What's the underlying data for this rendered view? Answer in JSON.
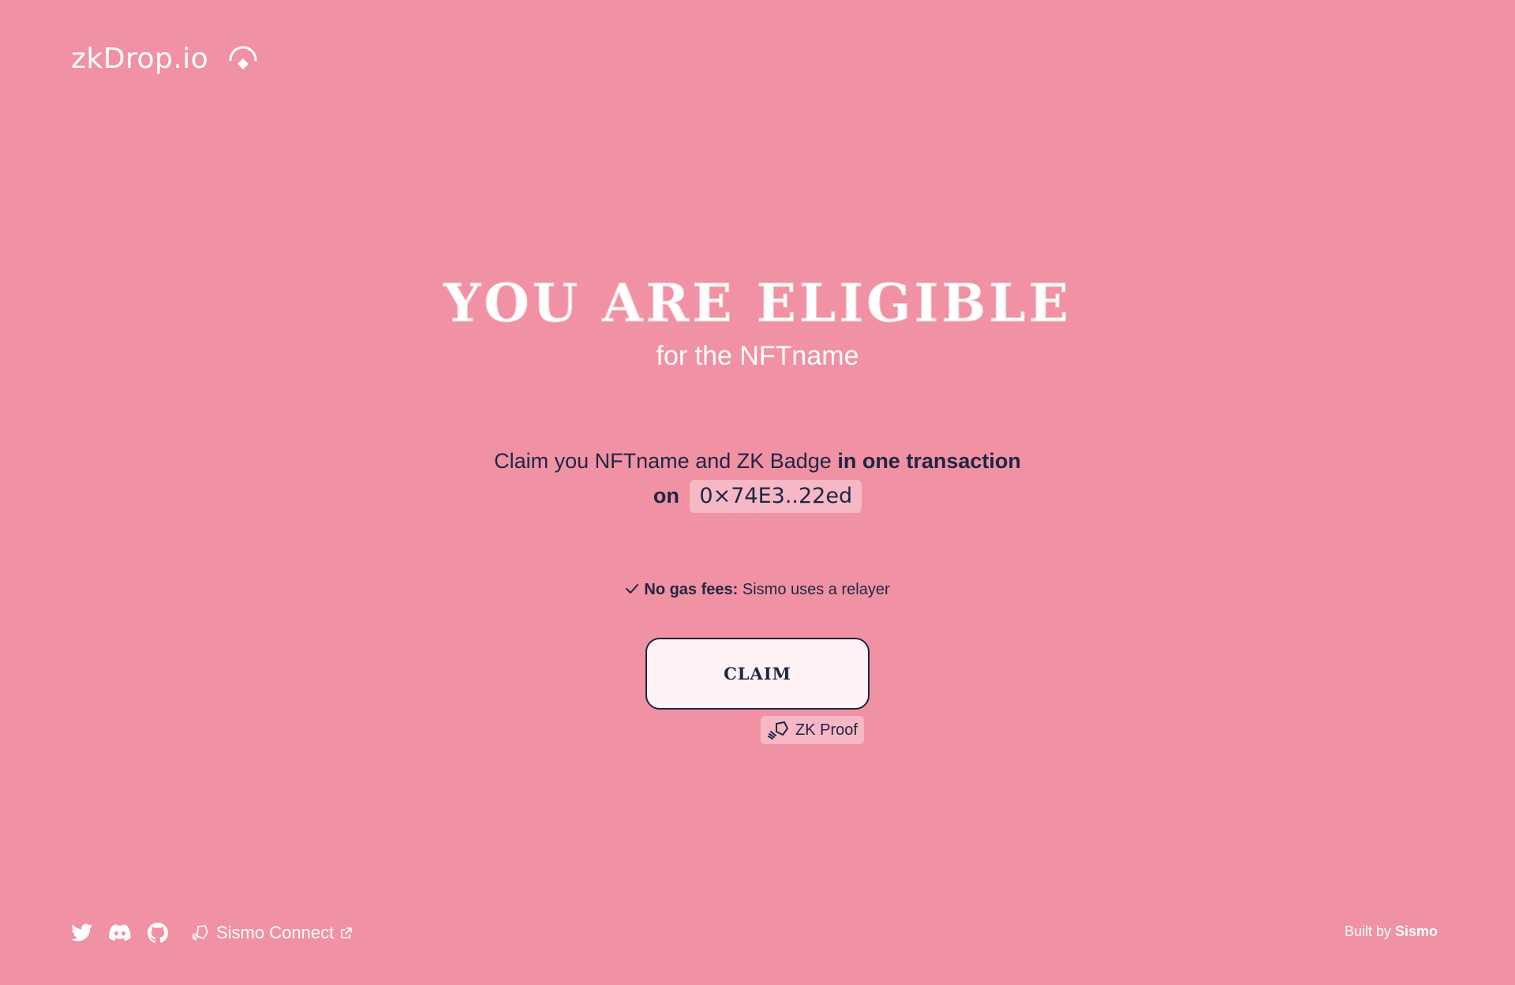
{
  "header": {
    "logo_text": "zkDrop.io",
    "logo_icon": "zkdrop-drop-icon"
  },
  "hero": {
    "title": "YOU ARE ELIGIBLE",
    "subtitle": "for the NFTname"
  },
  "claim": {
    "text_prefix": "Claim you NFTname and ZK Badge ",
    "text_bold": "in one transaction",
    "on_label": "on",
    "address": "0×74E3..22ed"
  },
  "gas": {
    "icon": "check-icon",
    "label_bold": "No gas fees:",
    "label_rest": " Sismo uses a relayer"
  },
  "claim_button": {
    "label": "CLAIM"
  },
  "zk_badge": {
    "icon": "zk-proof-icon",
    "label": "ZK Proof"
  },
  "footer": {
    "social": [
      {
        "name": "twitter-icon"
      },
      {
        "name": "discord-icon"
      },
      {
        "name": "github-icon"
      }
    ],
    "connect_label": "Sismo Connect",
    "built_by_prefix": "Built by ",
    "built_by_name": "Sismo"
  },
  "colors": {
    "background": "#F092A3",
    "text_dark": "#1F2544",
    "white": "#FFFFFF",
    "chip": "#F6B8C4",
    "button_bg": "#FEF2F4"
  }
}
